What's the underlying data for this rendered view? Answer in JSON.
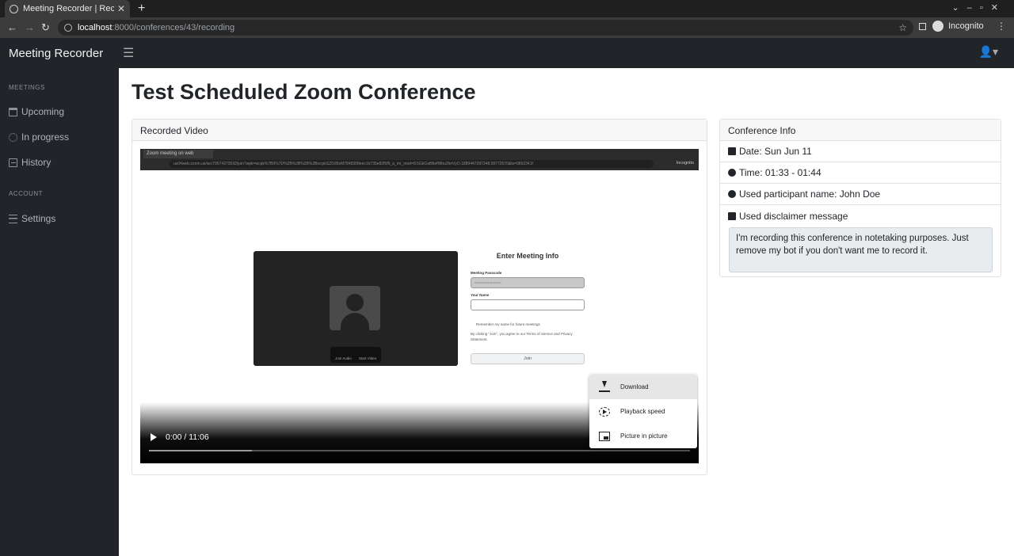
{
  "browser": {
    "tab_title": "Meeting Recorder | Recor",
    "url_host": "localhost",
    "url_path": ":8000/conferences/43/recording",
    "profile": "Incognito"
  },
  "app": {
    "brand": "Meeting Recorder",
    "page_title": "Test Scheduled Zoom Conference"
  },
  "sidebar": {
    "sections": [
      {
        "heading": "MEETINGS",
        "items": [
          "Upcoming",
          "In progress",
          "History"
        ]
      },
      {
        "heading": "ACCOUNT",
        "items": [
          "Settings"
        ]
      }
    ]
  },
  "video_card": {
    "title": "Recorded Video",
    "player": {
      "time": "0:00 / 11:06",
      "menu": [
        "Download",
        "Playback speed",
        "Picture in picture"
      ]
    },
    "embedded": {
      "tab_title": "Zoom meeting on web",
      "url": "us04web.zoom.us/wc/79574373592/join?wpk=wcpk%7B0%7D%2B%2B%2B%2BwcpkSZ5XBzM7848308eec1b735e82f5f6_a_mr_mod=8.5GkGaftNefWbu2hnVyO.1889447287348.58772570&ts=9862341f",
      "incognito": "Incognito",
      "form_title": "Enter Meeting Info",
      "passcode_label": "Meeting Passcode",
      "passcode_value": "••••••••••••••••••••••••",
      "name_label": "Your Name",
      "remember": "Remember my name for future meetings",
      "terms": "By clicking \"Join\", you agree to our Terms of Service and Privacy Statement.",
      "join": "Join",
      "join_audio": "Join Audio",
      "start_video": "Start Video"
    }
  },
  "info_card": {
    "title": "Conference Info",
    "date": "Date: Sun Jun 11",
    "time": "Time: 01:33 - 01:44",
    "participant": "Used participant name: John Doe",
    "disclaimer_label": "Used disclaimer message",
    "disclaimer_text": "I'm recording this conference in notetaking purposes. Just remove my bot if you don't want me to record it."
  }
}
